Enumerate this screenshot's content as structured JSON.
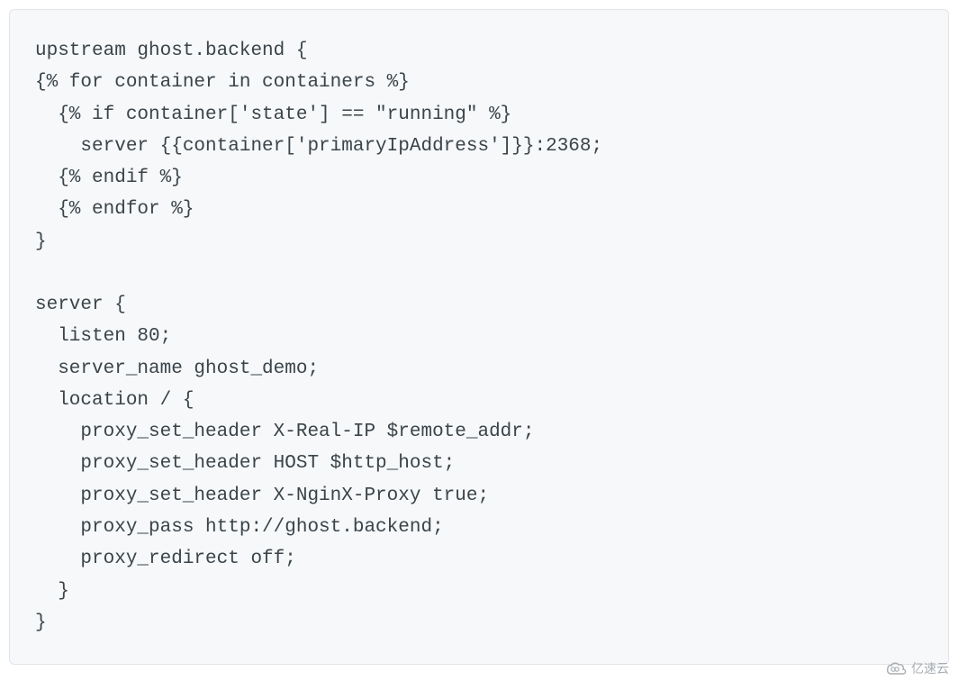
{
  "code": {
    "lines": [
      "upstream ghost.backend {",
      "{% for container in containers %}",
      "  {% if container['state'] == \"running\" %}",
      "    server {{container['primaryIpAddress']}}:2368;",
      "  {% endif %}",
      "  {% endfor %}",
      "}",
      "",
      "server {",
      "  listen 80;",
      "  server_name ghost_demo;",
      "  location / {",
      "    proxy_set_header X-Real-IP $remote_addr;",
      "    proxy_set_header HOST $http_host;",
      "    proxy_set_header X-NginX-Proxy true;",
      "    proxy_pass http://ghost.backend;",
      "    proxy_redirect off;",
      "  }",
      "}"
    ]
  },
  "watermark": {
    "text": "亿速云"
  }
}
